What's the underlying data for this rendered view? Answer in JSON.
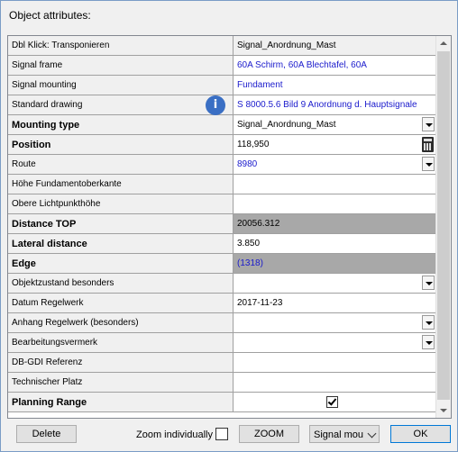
{
  "window": {
    "title": "Object attributes:"
  },
  "grid": {
    "header": {
      "label": "Dbl Klick: Transponieren",
      "value": "Signal_Anordnung_Mast"
    },
    "rows": [
      {
        "label": "Signal frame",
        "value": "60A Schirm, 60A Blechtafel, 60A",
        "bold": false,
        "style": "link",
        "control": "none"
      },
      {
        "label": "Signal mounting",
        "value": "Fundament",
        "bold": false,
        "style": "link",
        "control": "none"
      },
      {
        "label": "Standard drawing",
        "value": "S 8000.5.6 Bild 9 Anordnung d. Hauptsignale",
        "bold": false,
        "style": "link",
        "control": "none"
      },
      {
        "label": "Mounting type",
        "value": "Signal_Anordnung_Mast",
        "bold": true,
        "style": "normal",
        "control": "dropdown"
      },
      {
        "label": "Position",
        "value": "118,950",
        "bold": true,
        "style": "normal",
        "control": "calculator"
      },
      {
        "label": "Route",
        "value": "8980",
        "bold": false,
        "style": "link",
        "control": "dropdown"
      },
      {
        "label": "Höhe Fundamentoberkante",
        "value": "",
        "bold": false,
        "style": "normal",
        "control": "none"
      },
      {
        "label": "Obere Lichtpunkthöhe",
        "value": "",
        "bold": false,
        "style": "normal",
        "control": "none"
      },
      {
        "label": "Distance TOP",
        "value": "20056.312",
        "bold": true,
        "style": "gray",
        "control": "none"
      },
      {
        "label": "Lateral distance",
        "value": "3.850",
        "bold": true,
        "style": "normal",
        "control": "none"
      },
      {
        "label": "Edge",
        "value": "(1318)",
        "bold": true,
        "style": "gray-link",
        "control": "none"
      },
      {
        "label": "Objektzustand besonders",
        "value": "",
        "bold": false,
        "style": "normal",
        "control": "dropdown"
      },
      {
        "label": "Datum Regelwerk",
        "value": "2017-11-23",
        "bold": false,
        "style": "normal",
        "control": "none"
      },
      {
        "label": "Anhang Regelwerk (besonders)",
        "value": "",
        "bold": false,
        "style": "normal",
        "control": "dropdown"
      },
      {
        "label": "Bearbeitungsvermerk",
        "value": "",
        "bold": false,
        "style": "normal",
        "control": "dropdown"
      },
      {
        "label": "DB-GDI Referenz",
        "value": "",
        "bold": false,
        "style": "normal",
        "control": "none"
      },
      {
        "label": "Technischer Platz",
        "value": "",
        "bold": false,
        "style": "normal",
        "control": "none"
      },
      {
        "label": "Planning Range",
        "value": "",
        "bold": true,
        "style": "normal",
        "control": "checkbox-checked"
      }
    ]
  },
  "info_badge": {
    "icon": "info-icon",
    "glyph": "i",
    "color": "#3a6fc4"
  },
  "footer": {
    "delete_label": "Delete",
    "zoom_individually_label": "Zoom individually",
    "zoom_label": "ZOOM",
    "select_value": "Signal mou",
    "ok_label": "OK"
  },
  "colors": {
    "link": "#1a1acc",
    "gray_cell": "#a8a8a8",
    "accent": "#0078d7"
  }
}
